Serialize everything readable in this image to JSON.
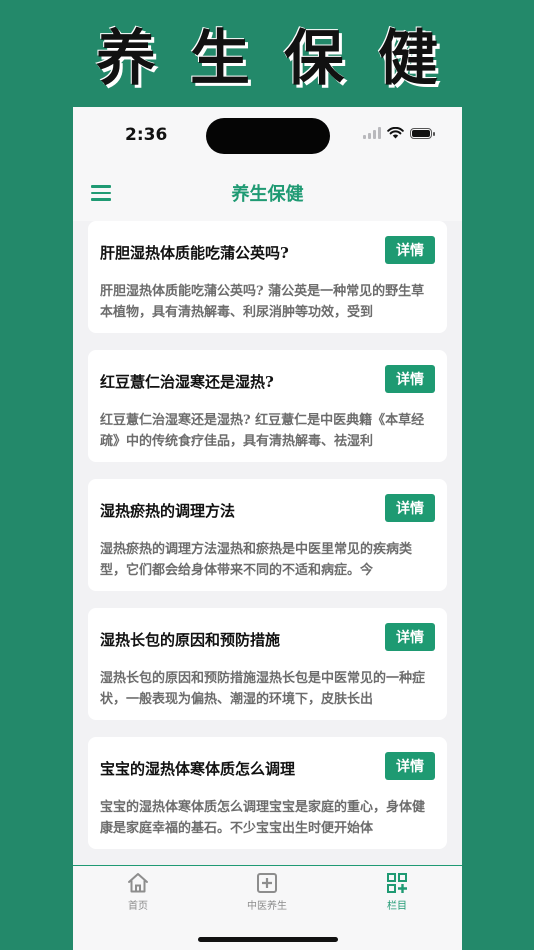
{
  "banner": {
    "title": "养生保健"
  },
  "status_bar": {
    "time": "2:36"
  },
  "nav": {
    "title": "养生保健",
    "menu_icon": "hamburger-menu-icon"
  },
  "articles": [
    {
      "title": "肝胆湿热体质能吃蒲公英吗?",
      "summary": "肝胆湿热体质能吃蒲公英吗? 蒲公英是一种常见的野生草本植物，具有清热解毒、利尿消肿等功效，受到",
      "button": "详情"
    },
    {
      "title": "红豆薏仁治湿寒还是湿热?",
      "summary": "红豆薏仁治湿寒还是湿热? 红豆薏仁是中医典籍《本草经疏》中的传统食疗佳品，具有清热解毒、祛湿利",
      "button": "详情"
    },
    {
      "title": "湿热瘀热的调理方法",
      "summary": "湿热瘀热的调理方法湿热和瘀热是中医里常见的疾病类型，它们都会给身体带来不同的不适和病症。今",
      "button": "详情"
    },
    {
      "title": "湿热长包的原因和预防措施",
      "summary": "湿热长包的原因和预防措施湿热长包是中医常见的一种症状，一般表现为偏热、潮湿的环境下，皮肤长出",
      "button": "详情"
    },
    {
      "title": "宝宝的湿热体寒体质怎么调理",
      "summary": "宝宝的湿热体寒体质怎么调理宝宝是家庭的重心，身体健康是家庭幸福的基石。不少宝宝出生时便开始体",
      "button": "详情"
    }
  ],
  "tabs": [
    {
      "label": "首页",
      "icon": "home-icon"
    },
    {
      "label": "中医养生",
      "icon": "medical-cross-icon"
    },
    {
      "label": "栏目",
      "icon": "qr-grid-icon",
      "active": true
    }
  ],
  "colors": {
    "accent": "#1f9a73",
    "background": "#23896a",
    "button": "#1e9a72"
  }
}
